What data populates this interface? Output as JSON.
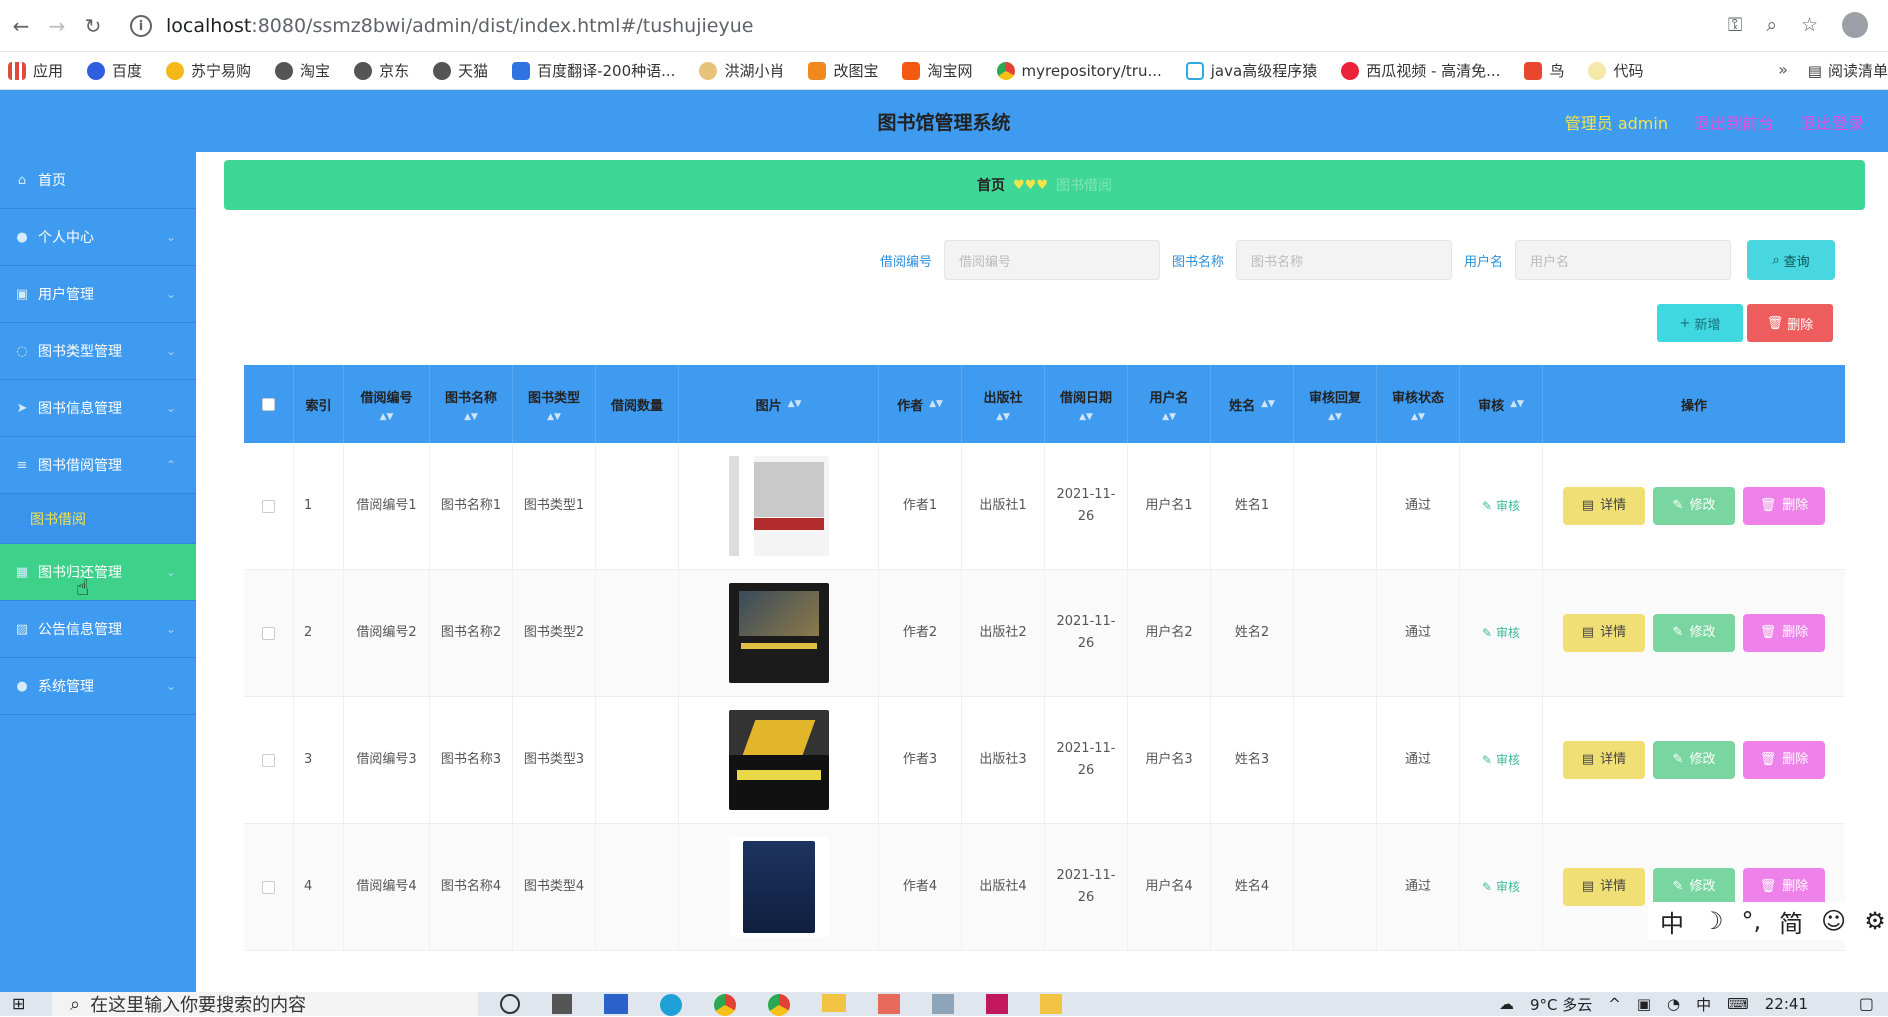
{
  "browser": {
    "url_host": "localhost",
    "url_rest": ":8080/ssmz8bwi/admin/dist/index.html#/tushujieyue",
    "bookmarks": [
      "应用",
      "百度",
      "苏宁易购",
      "淘宝",
      "京东",
      "天猫",
      "百度翻译-200种语...",
      "洪湖小肖",
      "改图宝",
      "淘宝网",
      "myrepository/tru...",
      "java高级程序猿",
      "西瓜视频 - 高清免...",
      "鸟",
      "代码"
    ],
    "bookmarks_more": "»",
    "reading_list": "阅读清单"
  },
  "header": {
    "title": "图书馆管理系统",
    "admin": "管理员 admin",
    "back_front": "退出到前台",
    "logout": "退出登录"
  },
  "sidebar": {
    "items": [
      {
        "label": "首页"
      },
      {
        "label": "个人中心"
      },
      {
        "label": "用户管理"
      },
      {
        "label": "图书类型管理"
      },
      {
        "label": "图书信息管理"
      },
      {
        "label": "图书借阅管理"
      },
      {
        "label": "图书借阅"
      },
      {
        "label": "图书归还管理"
      },
      {
        "label": "公告信息管理"
      },
      {
        "label": "系统管理"
      }
    ]
  },
  "breadcrumb": {
    "home": "首页",
    "sep": "♥♥♥",
    "current": "图书借阅"
  },
  "search": {
    "label1": "借阅编号",
    "placeholder1": "借阅编号",
    "label2": "图书名称",
    "placeholder2": "图书名称",
    "label3": "用户名",
    "placeholder3": "用户名",
    "query": "查询"
  },
  "actions": {
    "add": "新增",
    "delete": "删除"
  },
  "table": {
    "headers": [
      "索引",
      "借阅编号",
      "图书名称",
      "图书类型",
      "借阅数量",
      "图片",
      "作者",
      "出版社",
      "借阅日期",
      "用户名",
      "姓名",
      "审核回复",
      "审核状态",
      "审核",
      "操作"
    ],
    "rows": [
      {
        "idx": "1",
        "code": "借阅编号1",
        "name": "图书名称1",
        "type": "图书类型1",
        "qty": "",
        "author": "作者1",
        "publisher": "出版社1",
        "date": "2021-11-26",
        "user": "用户名1",
        "realname": "姓名1",
        "reply": "",
        "status": "通过",
        "audit": "审核"
      },
      {
        "idx": "2",
        "code": "借阅编号2",
        "name": "图书名称2",
        "type": "图书类型2",
        "qty": "",
        "author": "作者2",
        "publisher": "出版社2",
        "date": "2021-11-26",
        "user": "用户名2",
        "realname": "姓名2",
        "reply": "",
        "status": "通过",
        "audit": "审核"
      },
      {
        "idx": "3",
        "code": "借阅编号3",
        "name": "图书名称3",
        "type": "图书类型3",
        "qty": "",
        "author": "作者3",
        "publisher": "出版社3",
        "date": "2021-11-26",
        "user": "用户名3",
        "realname": "姓名3",
        "reply": "",
        "status": "通过",
        "audit": "审核"
      },
      {
        "idx": "4",
        "code": "借阅编号4",
        "name": "图书名称4",
        "type": "图书类型4",
        "qty": "",
        "author": "作者4",
        "publisher": "出版社4",
        "date": "2021-11-26",
        "user": "用户名4",
        "realname": "姓名4",
        "reply": "",
        "status": "通过",
        "audit": "审核"
      }
    ],
    "op_detail": "详情",
    "op_edit": "修改",
    "op_delete": "删除"
  },
  "ime": {
    "lang": "中",
    "moon": "☽",
    "punct": "°,",
    "simp": "简",
    "emoji": "☺",
    "gear": "⚙"
  },
  "taskbar": {
    "search_placeholder": "在这里输入你要搜索的内容",
    "weather": "9°C 多云",
    "time": "22:41",
    "ime": "中"
  }
}
